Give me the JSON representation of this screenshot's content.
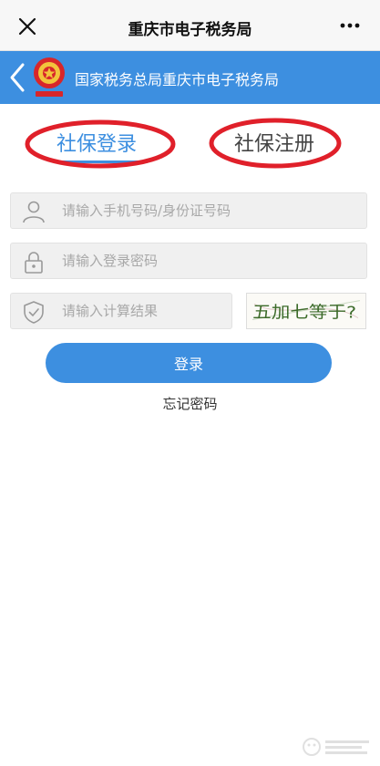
{
  "topbar": {
    "title": "重庆市电子税务局",
    "close_icon": "close-icon",
    "more_icon": "more-dots-icon"
  },
  "header": {
    "title": "国家税务总局重庆市电子税务局",
    "back_icon": "chevron-left-icon",
    "emblem_icon": "tax-emblem-icon"
  },
  "tabs": {
    "login": "社保登录",
    "register": "社保注册",
    "active": "login"
  },
  "form": {
    "phone_placeholder": "请输入手机号码/身份证号码",
    "password_placeholder": "请输入登录密码",
    "captcha_placeholder": "请输入计算结果",
    "captcha_image_text": "五加七等于?"
  },
  "buttons": {
    "login": "登录",
    "forgot": "忘记密码"
  },
  "colors": {
    "accent": "#3d8fe0",
    "annotation_red": "#e0202a",
    "field_bg": "#f0f0f0"
  }
}
